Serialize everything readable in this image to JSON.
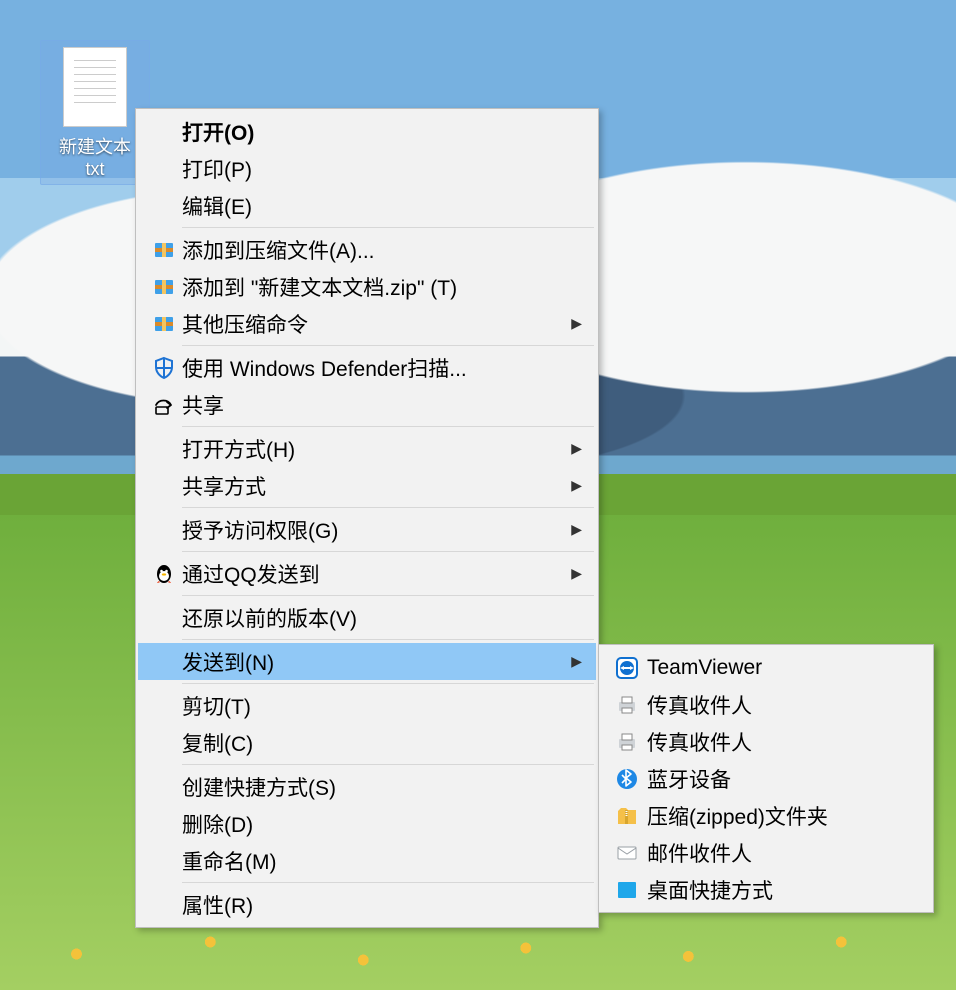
{
  "desktop": {
    "file_label_1": "新建文本",
    "file_label_2": "txt"
  },
  "context_menu": {
    "open": "打开(O)",
    "print": "打印(P)",
    "edit": "编辑(E)",
    "add_archive": "添加到压缩文件(A)...",
    "add_zip": "添加到 \"新建文本文档.zip\" (T)",
    "other_zip": "其他压缩命令",
    "defender": "使用 Windows Defender扫描...",
    "share": "共享",
    "open_with": "打开方式(H)",
    "share_with": "共享方式",
    "grant_access": "授予访问权限(G)",
    "qq_send": "通过QQ发送到",
    "restore_prev": "还原以前的版本(V)",
    "send_to": "发送到(N)",
    "cut": "剪切(T)",
    "copy": "复制(C)",
    "shortcut": "创建快捷方式(S)",
    "delete": "删除(D)",
    "rename": "重命名(M)",
    "properties": "属性(R)"
  },
  "send_to_menu": {
    "teamviewer": "TeamViewer",
    "fax1": "传真收件人",
    "fax2": "传真收件人",
    "bluetooth": "蓝牙设备",
    "zip_folder": "压缩(zipped)文件夹",
    "mail": "邮件收件人",
    "desk_link": "桌面快捷方式"
  }
}
